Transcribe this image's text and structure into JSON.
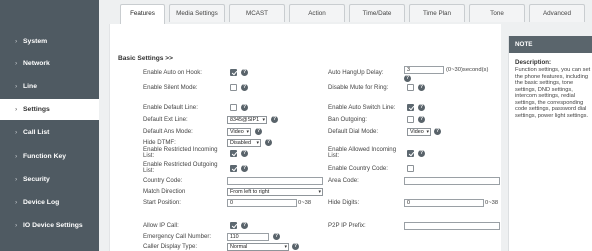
{
  "sidebar": {
    "items": [
      {
        "label": "System"
      },
      {
        "label": "Network"
      },
      {
        "label": "Line"
      },
      {
        "label": "Settings"
      },
      {
        "label": "Call List"
      },
      {
        "label": "Function Key"
      },
      {
        "label": "Security"
      },
      {
        "label": "Device Log"
      },
      {
        "label": "IO Device Settings"
      }
    ],
    "chevron": "›"
  },
  "tabs": [
    {
      "label": "Features"
    },
    {
      "label": "Media Settings"
    },
    {
      "label": "MCAST"
    },
    {
      "label": "Action"
    },
    {
      "label": "Time/Date"
    },
    {
      "label": "Time Plan"
    },
    {
      "label": "Tone"
    },
    {
      "label": "Advanced"
    }
  ],
  "main": {
    "section_title": "Basic Settings >>",
    "help_glyph": "?",
    "fields": {
      "auto_on_hook": {
        "label": "Enable Auto on Hook:",
        "checked": true
      },
      "auto_hangup_delay": {
        "label": "Auto HangUp Delay:",
        "value": "3",
        "unit": "(0~30)second(s)"
      },
      "silent_mode": {
        "label": "Enable Silent Mode:",
        "checked": false
      },
      "disable_mute_ring": {
        "label": "Disable Mute for Ring:",
        "checked": false
      },
      "default_line": {
        "label": "Enable Default Line:",
        "checked": false
      },
      "auto_switch_line": {
        "label": "Enable Auto Switch Line:",
        "checked": true
      },
      "default_ext_line": {
        "label": "Default Ext Line:",
        "value": "8345@SIP1"
      },
      "ban_outgoing": {
        "label": "Ban Outgoing:",
        "checked": false
      },
      "default_ans_mode": {
        "label": "Default Ans Mode:",
        "value": "Video"
      },
      "default_dial_mode": {
        "label": "Default Dial Mode:",
        "value": "Video"
      },
      "hide_dtmf": {
        "label": "Hide DTMF:",
        "value": "Disabled"
      },
      "restricted_incoming": {
        "label": "Enable Restricted Incoming List:",
        "checked": true
      },
      "allowed_incoming": {
        "label": "Enable Allowed Incoming List:",
        "checked": true
      },
      "restricted_outgoing": {
        "label": "Enable Restricted Outgoing List:",
        "checked": true
      },
      "country_code_enable": {
        "label": "Enable Country Code:",
        "checked": false
      },
      "country_code": {
        "label": "Country Code:",
        "value": ""
      },
      "area_code": {
        "label": "Area Code:",
        "value": ""
      },
      "match_direction": {
        "label": "Match Direction",
        "value": "From left to right"
      },
      "start_position": {
        "label": "Start Position:",
        "value": "0",
        "unit": "0~38"
      },
      "hide_digits": {
        "label": "Hide Digits:",
        "value": "0",
        "unit": "0~38"
      },
      "allow_ip_call": {
        "label": "Allow IP Call:",
        "checked": true
      },
      "p2p_ip_prefix": {
        "label": "P2P IP Prefix:",
        "value": ""
      },
      "emergency_call_number": {
        "label": "Emergency Call Number:",
        "value": "110"
      },
      "caller_display_type": {
        "label": "Caller Display Type:",
        "value": "Normal"
      }
    }
  },
  "note": {
    "header": "NOTE",
    "title": "Description:",
    "text": "Function settings, you can set the phone features, including the basic settings, tone settings, DND settings, intercom settings, redial settings, the corresponding code settings, password dial settings, power light settings."
  },
  "colors": {
    "sidebar_bg": "#4f5a62",
    "accent_dark": "#5a656c",
    "page_bg": "#eef0f1"
  }
}
